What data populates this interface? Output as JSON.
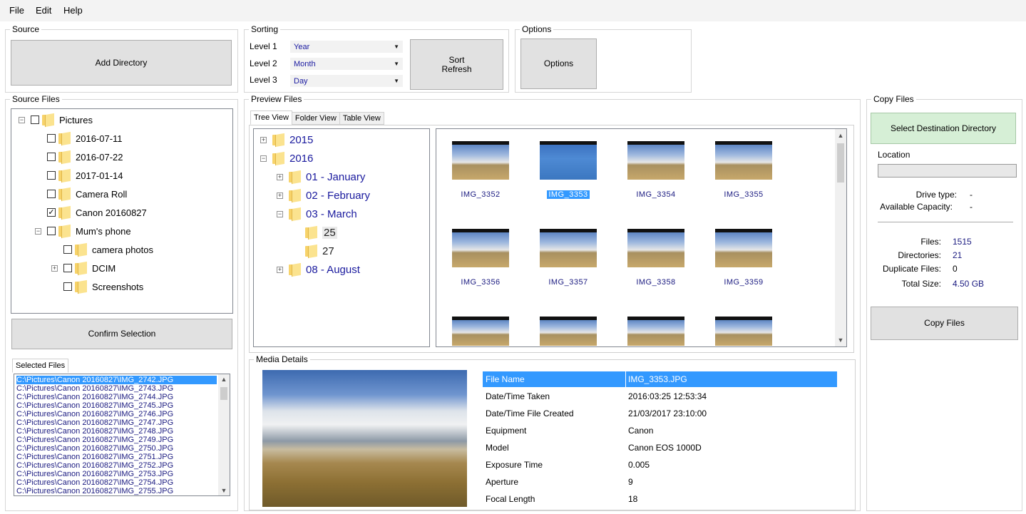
{
  "menu": [
    "File",
    "Edit",
    "Help"
  ],
  "source": {
    "title": "Source",
    "add_directory": "Add Directory"
  },
  "sorting": {
    "title": "Sorting",
    "levels": [
      {
        "label": "Level 1",
        "value": "Year"
      },
      {
        "label": "Level 2",
        "value": "Month"
      },
      {
        "label": "Level 3",
        "value": "Day"
      }
    ],
    "sort_refresh_line1": "Sort",
    "sort_refresh_line2": "Refresh"
  },
  "options": {
    "title": "Options",
    "button": "Options"
  },
  "source_files": {
    "title": "Source Files",
    "tree": [
      {
        "label": "Pictures",
        "indent": 0,
        "expander": "-",
        "checked": false
      },
      {
        "label": "2016-07-11",
        "indent": 1,
        "expander": "",
        "checked": false
      },
      {
        "label": "2016-07-22",
        "indent": 1,
        "expander": "",
        "checked": false
      },
      {
        "label": "2017-01-14",
        "indent": 1,
        "expander": "",
        "checked": false
      },
      {
        "label": "Camera Roll",
        "indent": 1,
        "expander": "",
        "checked": false
      },
      {
        "label": "Canon 20160827",
        "indent": 1,
        "expander": "",
        "checked": true
      },
      {
        "label": "Mum's phone",
        "indent": 1,
        "expander": "-",
        "checked": false
      },
      {
        "label": "camera photos",
        "indent": 2,
        "expander": "",
        "checked": false
      },
      {
        "label": "DCIM",
        "indent": 2,
        "expander": "+",
        "checked": false
      },
      {
        "label": "Screenshots",
        "indent": 2,
        "expander": "",
        "checked": false
      }
    ],
    "confirm_selection": "Confirm Selection",
    "selected_files_tab": "Selected Files",
    "selected_files": [
      "C:\\Pictures\\Canon 20160827\\IMG_2742.JPG",
      "C:\\Pictures\\Canon 20160827\\IMG_2743.JPG",
      "C:\\Pictures\\Canon 20160827\\IMG_2744.JPG",
      "C:\\Pictures\\Canon 20160827\\IMG_2745.JPG",
      "C:\\Pictures\\Canon 20160827\\IMG_2746.JPG",
      "C:\\Pictures\\Canon 20160827\\IMG_2747.JPG",
      "C:\\Pictures\\Canon 20160827\\IMG_2748.JPG",
      "C:\\Pictures\\Canon 20160827\\IMG_2749.JPG",
      "C:\\Pictures\\Canon 20160827\\IMG_2750.JPG",
      "C:\\Pictures\\Canon 20160827\\IMG_2751.JPG",
      "C:\\Pictures\\Canon 20160827\\IMG_2752.JPG",
      "C:\\Pictures\\Canon 20160827\\IMG_2753.JPG",
      "C:\\Pictures\\Canon 20160827\\IMG_2754.JPG",
      "C:\\Pictures\\Canon 20160827\\IMG_2755.JPG"
    ]
  },
  "preview": {
    "title": "Preview Files",
    "tabs": [
      "Tree View",
      "Folder View",
      "Table View"
    ],
    "tree": [
      {
        "label": "2015",
        "indent": 0,
        "expander": "+"
      },
      {
        "label": "2016",
        "indent": 0,
        "expander": "-"
      },
      {
        "label": "01 - January",
        "indent": 1,
        "expander": "+"
      },
      {
        "label": "02 - February",
        "indent": 1,
        "expander": "+"
      },
      {
        "label": "03 - March",
        "indent": 1,
        "expander": "-"
      },
      {
        "label": "25",
        "indent": 2,
        "expander": ""
      },
      {
        "label": "27",
        "indent": 2,
        "expander": ""
      },
      {
        "label": "08 - August",
        "indent": 1,
        "expander": "+"
      }
    ],
    "thumbnails": [
      {
        "name": "IMG_3352",
        "selected": false
      },
      {
        "name": "IMG_3353",
        "selected": true
      },
      {
        "name": "IMG_3354",
        "selected": false
      },
      {
        "name": "IMG_3355",
        "selected": false
      },
      {
        "name": "IMG_3356",
        "selected": false
      },
      {
        "name": "IMG_3357",
        "selected": false
      },
      {
        "name": "IMG_3358",
        "selected": false
      },
      {
        "name": "IMG_3359",
        "selected": false
      }
    ]
  },
  "media_details": {
    "title": "Media Details",
    "rows": [
      {
        "key": "File Name",
        "value": "IMG_3353.JPG"
      },
      {
        "key": "Date/Time Taken",
        "value": "2016:03:25 12:53:34"
      },
      {
        "key": "Date/Time File Created",
        "value": "21/03/2017 23:10:00"
      },
      {
        "key": "Equipment",
        "value": "Canon"
      },
      {
        "key": "Model",
        "value": "Canon EOS 1000D"
      },
      {
        "key": "Exposure Time",
        "value": "0.005"
      },
      {
        "key": "Aperture",
        "value": "9"
      },
      {
        "key": "Focal Length",
        "value": "18"
      }
    ]
  },
  "copy_files": {
    "title": "Copy Files",
    "select_destination": "Select Destination Directory",
    "location_label": "Location",
    "drive_type_label": "Drive type:",
    "drive_type_value": "-",
    "capacity_label": "Available Capacity:",
    "capacity_value": "-",
    "files_label": "Files:",
    "files_value": "1515",
    "dirs_label": "Directories:",
    "dirs_value": "21",
    "dupes_label": "Duplicate Files:",
    "dupes_value": "0",
    "size_label": "Total Size:",
    "size_value": "4.50 GB",
    "copy_button": "Copy Files"
  },
  "colors": {
    "selection": "#3399ff",
    "value_text": "#1a1a80",
    "green_button": "#d6efd6"
  }
}
